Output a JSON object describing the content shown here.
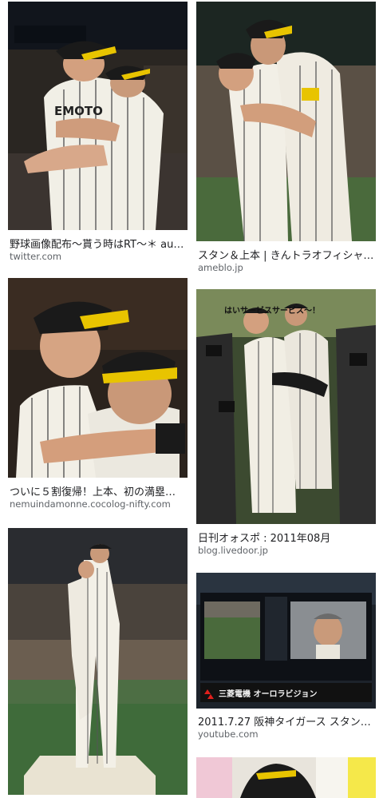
{
  "results": [
    {
      "caption": "野球画像配布〜貰う時はRT〜＊ auf…",
      "source": "twitter.com",
      "photo_text": "EMOTO"
    },
    {
      "caption": "スタン＆上本 | きんトラオフィシャ…",
      "source": "ameblo.jp"
    },
    {
      "caption": "ついに５割復帰！上本、初の満塁…",
      "source": "nemuindamonne.cocolog-nifty.com"
    },
    {
      "caption": "日刊オォスポ : 2011年08月",
      "source": "blog.livedoor.jp",
      "photo_text": "はいサービスサービス〜！"
    },
    {
      "caption": "",
      "source": ""
    },
    {
      "caption": "2011.7.27 阪神タイガース スタン…",
      "source": "youtube.com",
      "photo_text": "三菱電機 オーロラビジョン"
    },
    {
      "caption": "",
      "source": ""
    }
  ],
  "colors": {
    "stripe_uniform": "#f4f2ea",
    "cap_black": "#1a1a1a",
    "cap_yellow": "#e8c400",
    "field_green": "#3f6b3a"
  }
}
